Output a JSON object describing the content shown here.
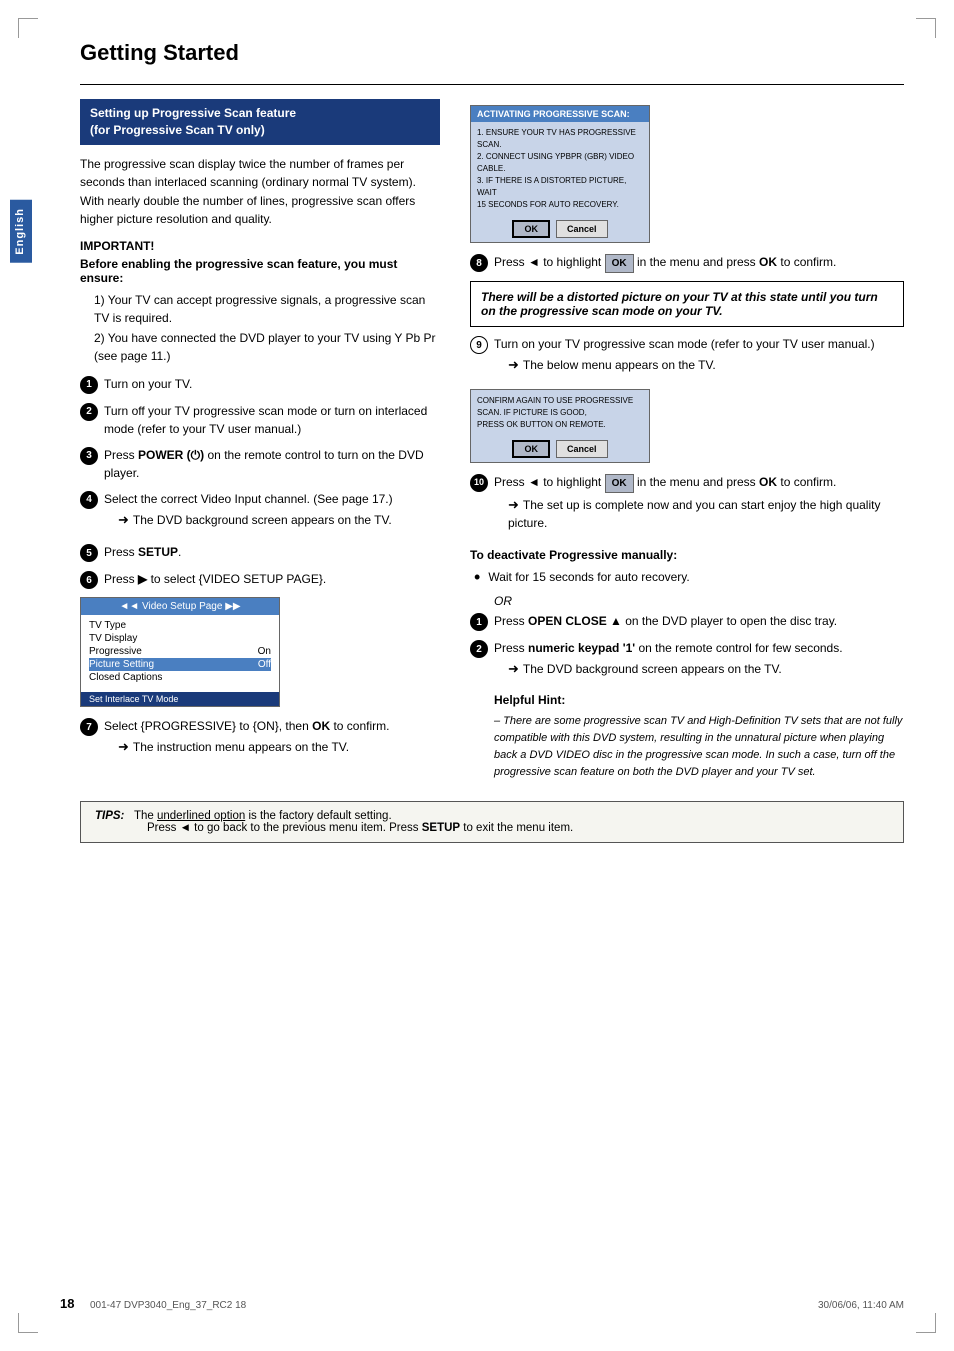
{
  "page": {
    "title": "Getting Started",
    "page_number": "18",
    "footer_left": "001-47 DVP3040_Eng_37_RC2          18",
    "footer_right": "30/06/06, 11:40 AM",
    "sidebar_label": "English"
  },
  "section_header": {
    "line1": "Setting up Progressive Scan feature",
    "line2": "(for Progressive Scan TV only)"
  },
  "intro_text": "The progressive scan display twice the number of frames per seconds than interlaced scanning (ordinary normal TV system). With nearly double the number of lines, progressive scan offers higher picture resolution and quality.",
  "important": {
    "heading": "IMPORTANT!",
    "subheading": "Before enabling the progressive scan feature, you must ensure:",
    "items": [
      "1) Your TV can accept progressive signals, a progressive scan TV is required.",
      "2) You have connected the DVD player to your TV using Y Pb Pr (see page 11.)"
    ]
  },
  "steps_left": [
    {
      "number": "1",
      "type": "filled",
      "text": "Turn on your TV."
    },
    {
      "number": "2",
      "type": "filled",
      "text": "Turn off your TV progressive scan mode or turn on interlaced mode (refer to your TV user manual.)"
    },
    {
      "number": "3",
      "type": "filled",
      "text": "Press POWER (⏻) on the remote control to turn on the DVD player."
    },
    {
      "number": "4",
      "type": "filled",
      "text": "Select the correct Video Input channel. (See page 17.)",
      "sub": "➜ The DVD background screen appears on the TV."
    },
    {
      "number": "5",
      "type": "filled",
      "text": "Press SETUP."
    },
    {
      "number": "6",
      "type": "filled",
      "text": "Press ▶ to select {VIDEO SETUP PAGE}."
    },
    {
      "number": "7",
      "type": "filled",
      "text": "Select {PROGRESSIVE} to {ON}, then OK to confirm.",
      "sub": "➜ The instruction menu appears on the TV."
    }
  ],
  "menu_box": {
    "header": "◄◄  Video Setup Page  ▶▶",
    "rows": [
      {
        "label": "TV Type",
        "value": "",
        "highlighted": false
      },
      {
        "label": "TV Display",
        "value": "",
        "highlighted": false
      },
      {
        "label": "Progressive",
        "value": "On",
        "highlighted": false
      },
      {
        "label": "Picture Setting",
        "value": "Off",
        "highlighted": true
      },
      {
        "label": "Closed Captions",
        "value": "",
        "highlighted": false
      }
    ],
    "footer": "Set Interlace TV Mode"
  },
  "dialog1": {
    "header": "ACTIVATING PROGRESSIVE SCAN:",
    "lines": [
      "1. ENSURE YOUR TV HAS PROGRESSIVE SCAN.",
      "2. CONNECT USING YPBPR (GBR) VIDEO CABLE.",
      "3. IF THERE IS A DISTORTED PICTURE, WAIT",
      "15 SECONDS FOR AUTO RECOVERY."
    ],
    "btn_ok": "OK",
    "btn_cancel": "Cancel"
  },
  "dialog2": {
    "header": "",
    "lines": [
      "CONFIRM AGAIN TO USE PROGRESSIVE",
      "SCAN. IF PICTURE IS GOOD,",
      "PRESS OK BUTTON ON REMOTE."
    ],
    "btn_ok": "OK",
    "btn_cancel": "Cancel"
  },
  "steps_right": [
    {
      "number": "8",
      "type": "filled",
      "text_before": "Press ◄ to highlight ",
      "ok_box": "OK",
      "text_after": " in the menu and press OK to confirm."
    },
    {
      "notice": "There will be a distorted picture on your TV at this state until you turn on the progressive scan mode on your TV."
    },
    {
      "number": "9",
      "type": "outlined",
      "text": "Turn on your TV progressive scan mode (refer to your TV user manual.)",
      "sub": "➜ The below menu appears on the TV."
    },
    {
      "number": "10",
      "type": "filled",
      "text_before": "Press ◄ to highlight ",
      "ok_box": "OK",
      "text_after": " in the menu and press OK to confirm.",
      "sub": "➜ The set up is complete now and you can start enjoy the high quality picture."
    }
  ],
  "deactivate": {
    "heading": "To deactivate Progressive manually:",
    "bullet1": "Wait for 15 seconds for auto recovery.",
    "or_text": "OR",
    "step1_number": "1",
    "step1_text": "Press OPEN CLOSE ▲ on the DVD player to open the disc tray.",
    "step2_number": "2",
    "step2_text": "Press numeric keypad '1' on the remote control for few seconds.",
    "step2_sub": "➜ The DVD background screen appears on the TV.",
    "hint_heading": "Helpful Hint:",
    "hint_text": "– There are some progressive scan TV and High-Definition TV sets that are not fully compatible with this DVD system, resulting in the unnatural picture when playing back a DVD VIDEO disc in the progressive scan mode. In such a case, turn off the progressive scan feature on both the DVD player and your TV set."
  },
  "tips": {
    "label": "TIPS:",
    "line1": "The underlined option is the factory default setting.",
    "line2_before": "Press ◄ to go back to the previous menu item. Press ",
    "line2_setup": "SETUP",
    "line2_after": " to exit the menu item."
  }
}
